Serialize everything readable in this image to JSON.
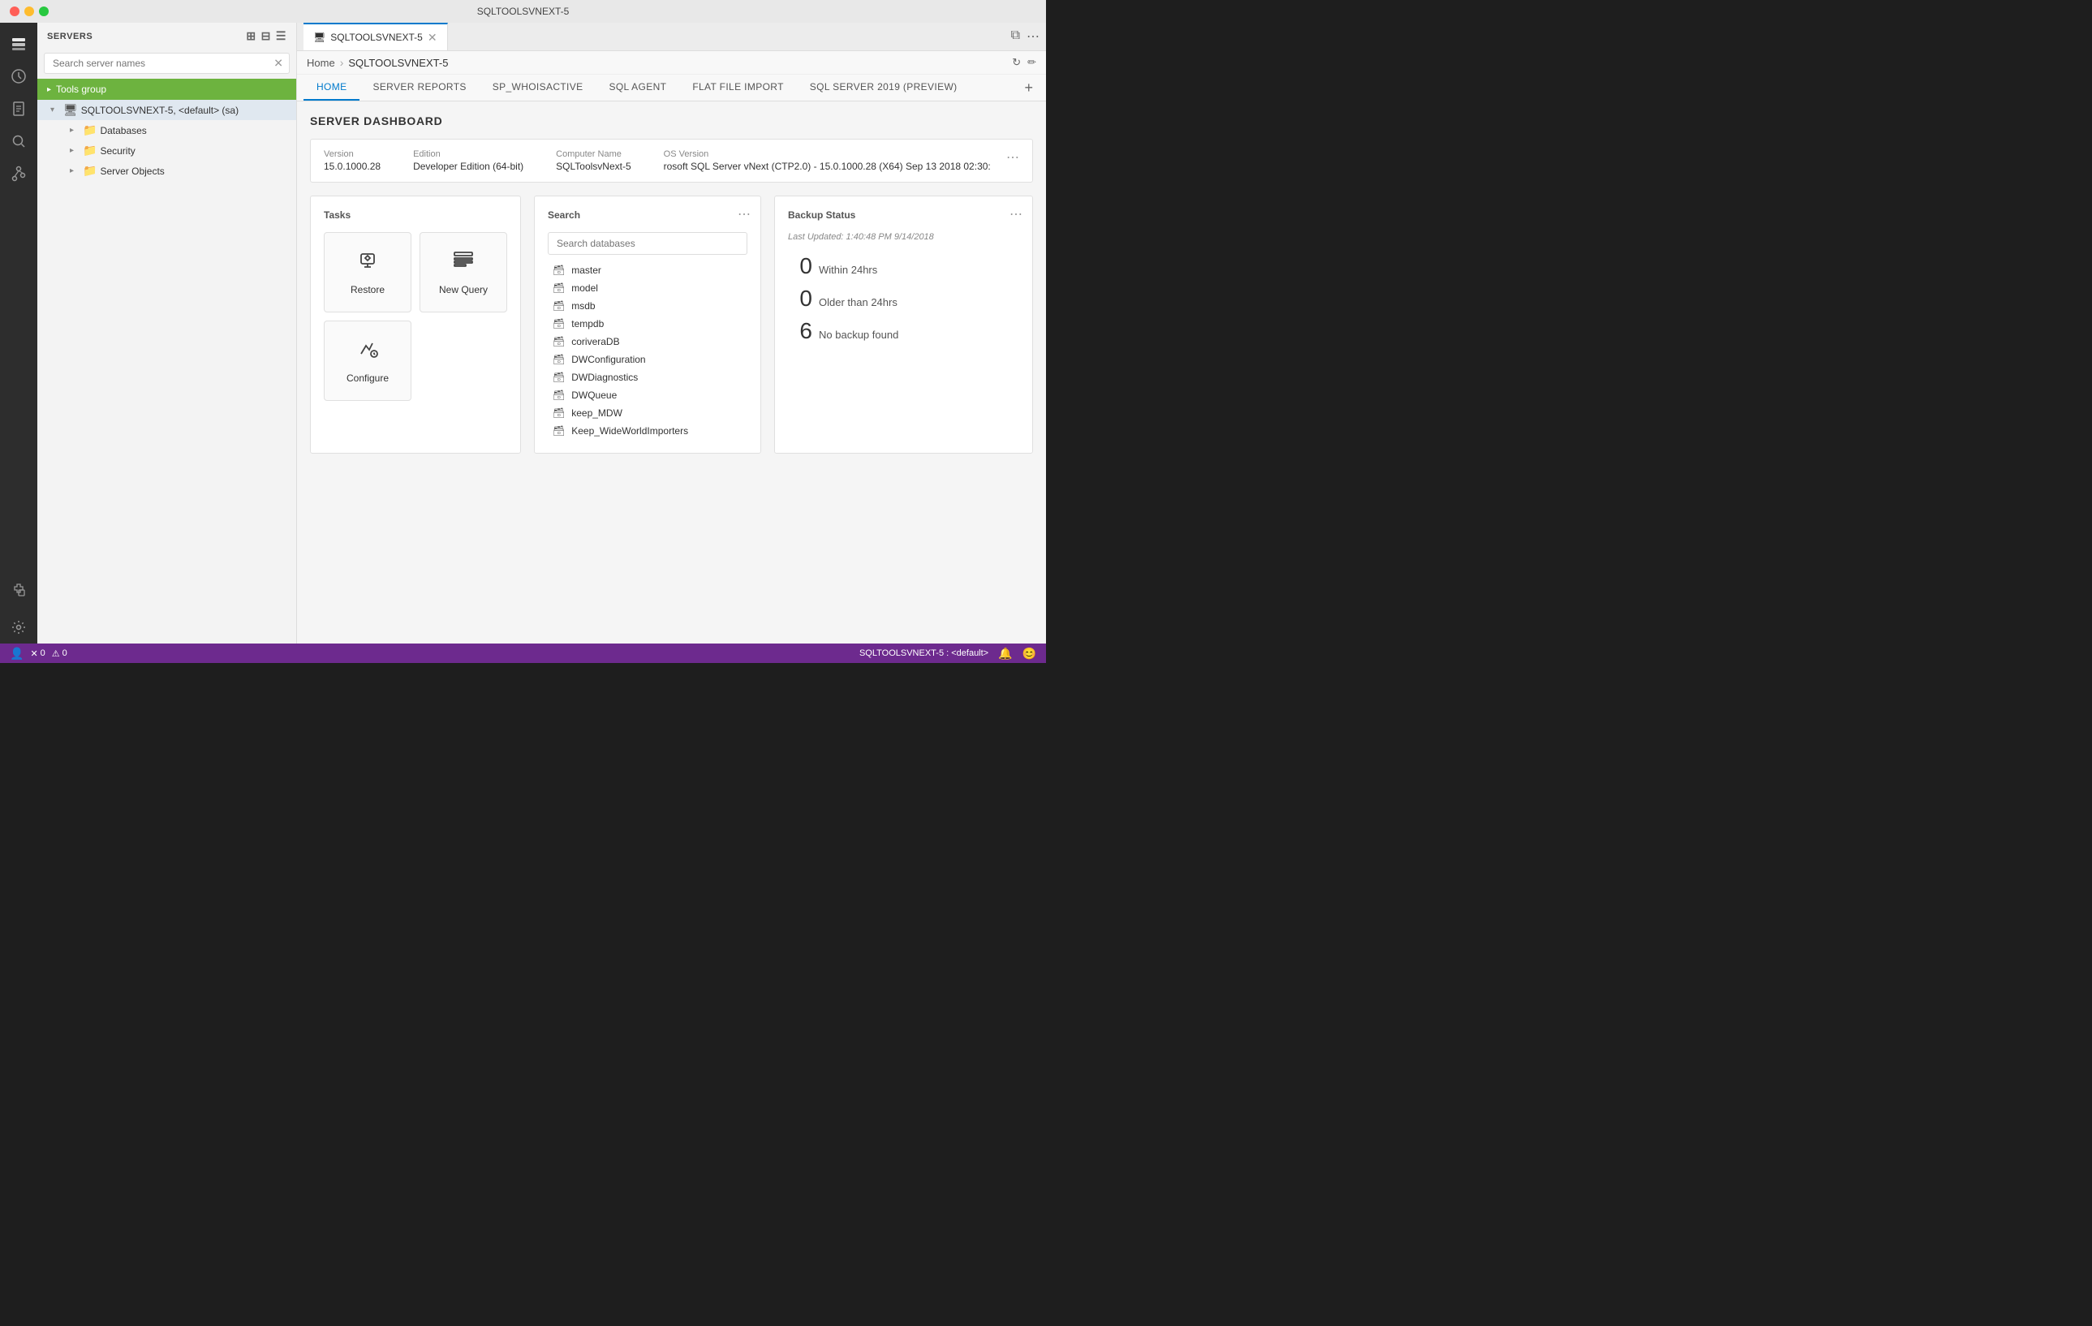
{
  "titlebar": {
    "title": "SQLTOOLSVNEXT-5"
  },
  "sidebar": {
    "header": "SERVERS",
    "search_placeholder": "Search server names",
    "tools_group": "Tools group",
    "server": {
      "name": "SQLTOOLSVNEXT-5, <default> (sa)",
      "children": [
        {
          "label": "Databases",
          "icon": "folder"
        },
        {
          "label": "Security",
          "icon": "folder"
        },
        {
          "label": "Server Objects",
          "icon": "folder"
        }
      ]
    }
  },
  "tab": {
    "label": "SQLTOOLSVNEXT-5"
  },
  "breadcrumb": {
    "home": "Home",
    "current": "SQLTOOLSVNEXT-5"
  },
  "nav_tabs": [
    {
      "label": "HOME",
      "active": true
    },
    {
      "label": "SERVER REPORTS"
    },
    {
      "label": "SP_WHOISACTIVE"
    },
    {
      "label": "SQL AGENT"
    },
    {
      "label": "FLAT FILE IMPORT"
    },
    {
      "label": "SQL SERVER 2019 (PREVIEW)"
    }
  ],
  "dashboard": {
    "title": "SERVER DASHBOARD",
    "server_info": {
      "version_label": "Version",
      "version_value": "15.0.1000.28",
      "edition_label": "Edition",
      "edition_value": "Developer Edition (64-bit)",
      "computer_label": "Computer Name",
      "computer_value": "SQLToolsvNext-5",
      "os_label": "OS Version",
      "os_value": "rosoft SQL Server vNext (CTP2.0) - 15.0.1000.28 (X64) Sep 13 2018 02:30:"
    },
    "tasks": {
      "title": "Tasks",
      "restore": "Restore",
      "new_query": "New Query",
      "configure": "Configure"
    },
    "search": {
      "title": "Search",
      "placeholder": "Search databases",
      "databases": [
        "master",
        "model",
        "msdb",
        "tempdb",
        "coriveraDB",
        "DWConfiguration",
        "DWDiagnostics",
        "DWQueue",
        "keep_MDW",
        "Keep_WideWorldImporters"
      ]
    },
    "backup": {
      "title": "Backup Status",
      "subtitle": "Last Updated: 1:40:48 PM 9/14/2018",
      "stats": [
        {
          "count": "0",
          "label": "Within 24hrs"
        },
        {
          "count": "0",
          "label": "Older than 24hrs"
        },
        {
          "count": "6",
          "label": "No backup found"
        }
      ]
    }
  },
  "status_bar": {
    "server": "SQLTOOLSVNEXT-5 : <default>",
    "errors": "0",
    "warnings": "0"
  },
  "activity_icons": [
    {
      "name": "servers-icon",
      "symbol": "⬡"
    },
    {
      "name": "history-icon",
      "symbol": "⏱"
    },
    {
      "name": "explorer-icon",
      "symbol": "📄"
    },
    {
      "name": "search-icon",
      "symbol": "🔍"
    },
    {
      "name": "git-icon",
      "symbol": "⑂"
    },
    {
      "name": "extensions-icon",
      "symbol": "⧉"
    }
  ]
}
